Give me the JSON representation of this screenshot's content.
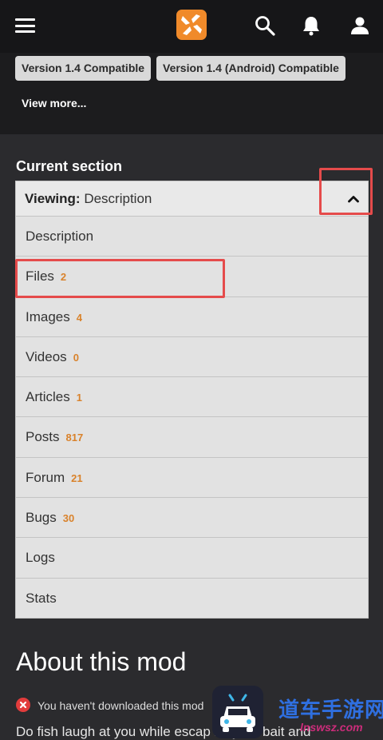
{
  "header": {
    "icons": [
      "menu-icon",
      "nexus-logo",
      "search-icon",
      "bell-icon",
      "user-icon"
    ],
    "logo_color": "#f08a2a"
  },
  "tags": [
    {
      "label": "Version 1.4 Compatible"
    },
    {
      "label": "Version 1.4 (Android) Compatible"
    }
  ],
  "view_more": "View more...",
  "current_section": {
    "heading": "Current section",
    "viewing_label": "Viewing:",
    "viewing_value": "Description",
    "items": [
      {
        "label": "Description",
        "count": ""
      },
      {
        "label": "Files",
        "count": "2"
      },
      {
        "label": "Images",
        "count": "4"
      },
      {
        "label": "Videos",
        "count": "0"
      },
      {
        "label": "Articles",
        "count": "1"
      },
      {
        "label": "Posts",
        "count": "817"
      },
      {
        "label": "Forum",
        "count": "21"
      },
      {
        "label": "Bugs",
        "count": "30"
      },
      {
        "label": "Logs",
        "count": ""
      },
      {
        "label": "Stats",
        "count": ""
      }
    ]
  },
  "about": {
    "title": "About this mod",
    "notice": "You haven't downloaded this mod",
    "description": "Do fish laugh at you while escap      ith your bait and"
  },
  "watermark": {
    "text": "道车手游网",
    "url": "lnswsz.com"
  },
  "colors": {
    "accent": "#d9822b",
    "highlight": "#e54b4b",
    "background": "#2b2b2e"
  }
}
